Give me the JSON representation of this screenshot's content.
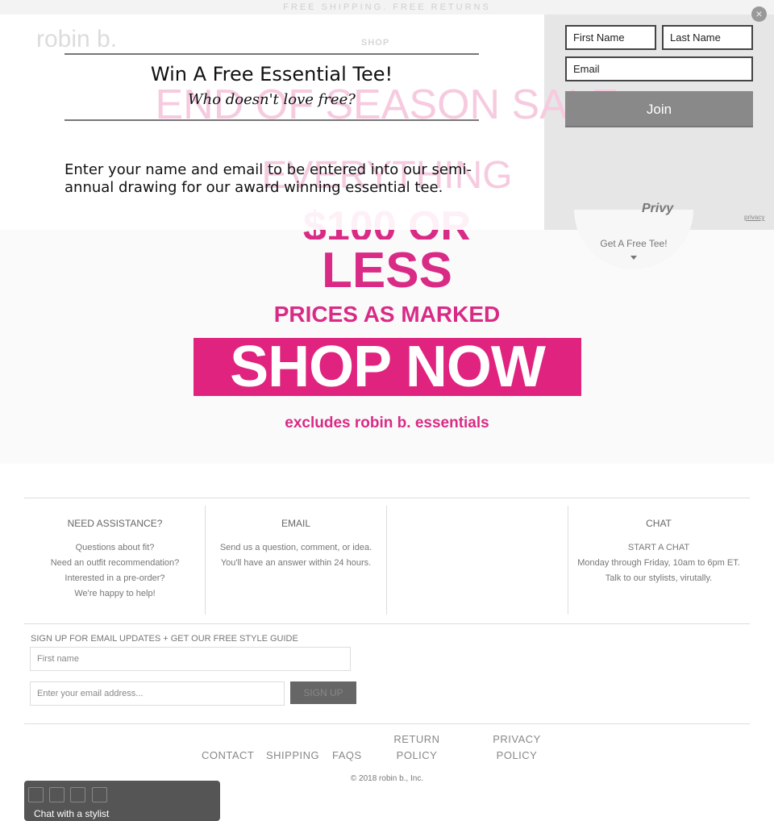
{
  "header": {
    "promo": "FREE SHIPPING. FREE RETURNS",
    "logo": "robin b.",
    "nav_shop": "SHOP"
  },
  "banner": {
    "line1": "END OF SEASON SALE",
    "line2": "EVERYTHING",
    "line3": "$100 OR",
    "line4": "LESS",
    "line5": "PRICES AS MARKED",
    "cta": "SHOP NOW",
    "note": "excludes robin b. essentials",
    "accent": "#e0237f"
  },
  "free_tab": {
    "label": "Get A Free Tee!"
  },
  "popup": {
    "title": "Win A Free Essential Tee!",
    "subtitle": "Who doesn't love free?",
    "body": "Enter your name and email to be entered into our semi-annual drawing for our award winning essential tee.",
    "first_name_placeholder": "First Name",
    "last_name_placeholder": "Last Name",
    "email_placeholder": "Email",
    "join": "Join",
    "powered": "Privy",
    "privacy": "privacy"
  },
  "footer": {
    "columns": [
      {
        "title": "NEED ASSISTANCE?",
        "lines": [
          "Questions about fit?",
          "Need an outfit recommendation?",
          "Interested in a pre-order?",
          "We're happy to help!"
        ]
      },
      {
        "title": "EMAIL",
        "lines": [
          "Send us a question, comment, or idea.",
          "You'll have an answer within 24 hours."
        ]
      },
      {
        "title": "CHAT",
        "lines": [
          "START A CHAT",
          "Monday through Friday, 10am to 6pm ET.",
          "Talk to our stylists, virutally."
        ]
      }
    ],
    "signup_label": "SIGN UP FOR EMAIL UPDATES + GET OUR FREE STYLE GUIDE",
    "first_name_placeholder": "First name",
    "email_placeholder": "Enter your email address...",
    "signup_button": "SIGN UP",
    "links": [
      "CONTACT",
      "SHIPPING",
      "FAQS",
      "RETURN",
      "POLICY",
      "PRIVACY",
      "POLICY"
    ],
    "copyright": "© 2018 robin b., Inc."
  },
  "chat_widget": {
    "label": "Chat with a stylist"
  }
}
